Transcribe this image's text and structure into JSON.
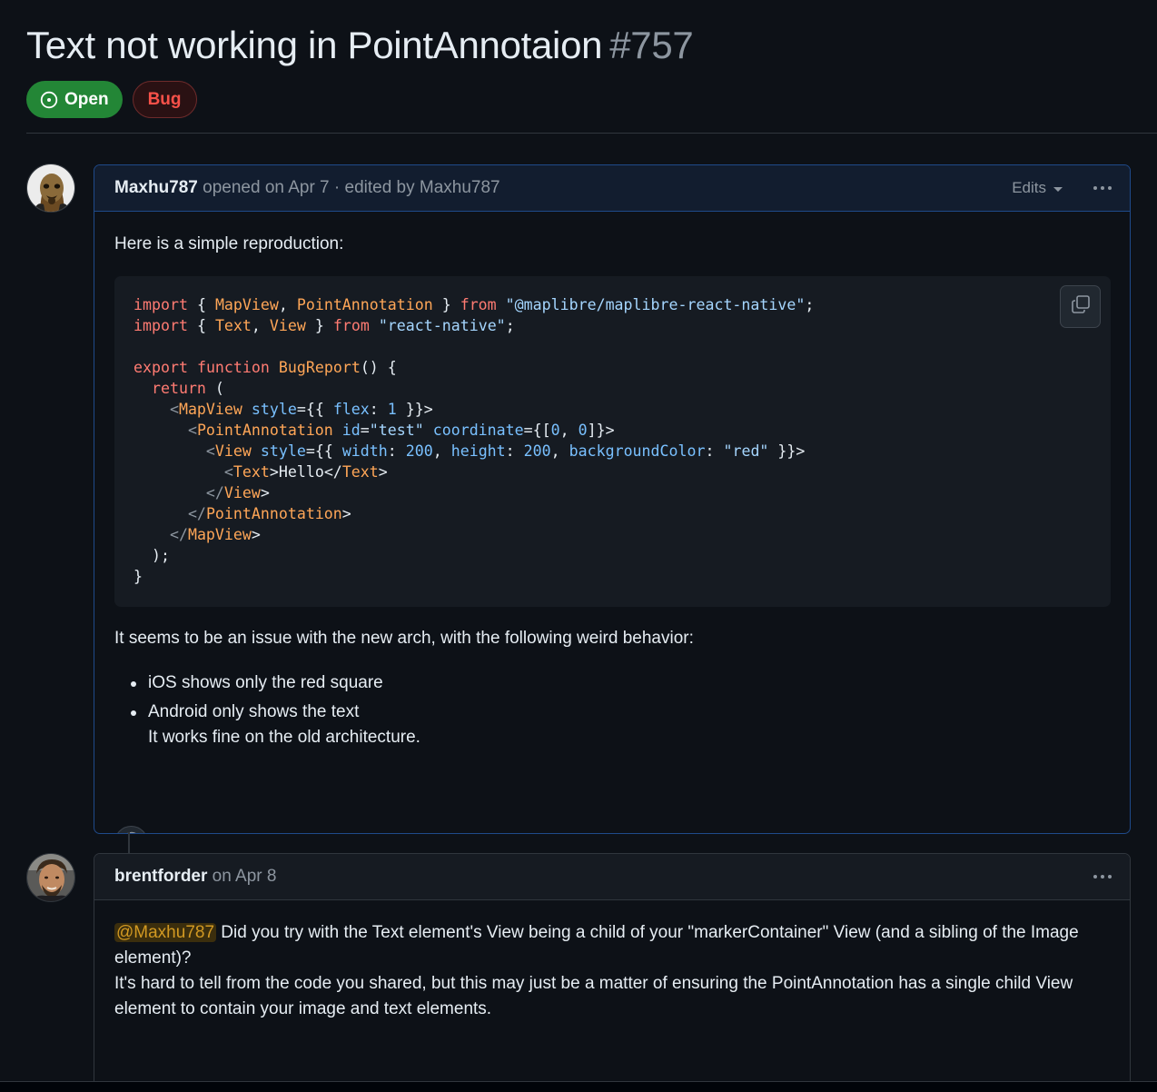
{
  "issue": {
    "title": "Text not working in PointAnnotaion",
    "number": "#757",
    "state": "Open",
    "label": "Bug"
  },
  "colors": {
    "background": "#0d1117",
    "open_badge": "#238636",
    "bug_label": "#f85149",
    "author_border": "#1f4a8a"
  },
  "comments": [
    {
      "author": "Maxhu787",
      "meta": " opened on Apr 7 · edited by Maxhu787",
      "edits_label": "Edits",
      "intro": "Here is a simple reproduction:",
      "code": {
        "line1": {
          "p1": "import",
          "p2": " { ",
          "p3": "MapView",
          "p4": ", ",
          "p5": "PointAnnotation",
          "p6": " } ",
          "p7": "from",
          "p8": " ",
          "p9": "\"@maplibre/maplibre-react-native\"",
          "p10": ";"
        },
        "line2": {
          "p1": "import",
          "p2": " { ",
          "p3": "Text",
          "p4": ", ",
          "p5": "View",
          "p6": " } ",
          "p7": "from",
          "p8": " ",
          "p9": "\"react-native\"",
          "p10": ";"
        },
        "line4": {
          "p1": "export",
          "p2": " ",
          "p3": "function",
          "p4": " ",
          "p5": "BugReport",
          "p6": "() {"
        },
        "line5": {
          "p1": "  ",
          "p2": "return",
          "p3": " ("
        },
        "line6": {
          "p1": "    <",
          "p2": "MapView",
          "p3": " ",
          "p4": "style",
          "p5": "={{ ",
          "p6": "flex",
          "p7": ": ",
          "p8": "1",
          "p9": " }}>"
        },
        "line7": {
          "p1": "      <",
          "p2": "PointAnnotation",
          "p3": " ",
          "p4": "id",
          "p5": "=",
          "p6": "\"test\"",
          "p7": " ",
          "p8": "coordinate",
          "p9": "={[",
          "p10": "0",
          "p11": ", ",
          "p12": "0",
          "p13": "]}>"
        },
        "line8": {
          "p1": "        <",
          "p2": "View",
          "p3": " ",
          "p4": "style",
          "p5": "={{ ",
          "p6": "width",
          "p7": ": ",
          "p8": "200",
          "p9": ", ",
          "p10": "height",
          "p11": ": ",
          "p12": "200",
          "p13": ", ",
          "p14": "backgroundColor",
          "p15": ": ",
          "p16": "\"red\"",
          "p17": " }}>"
        },
        "line9": {
          "p1": "          <",
          "p2": "Text",
          "p3": ">Hello</",
          "p4": "Text",
          "p5": ">"
        },
        "line10": {
          "p1": "        </",
          "p2": "View",
          "p3": ">"
        },
        "line11": {
          "p1": "      </",
          "p2": "PointAnnotation",
          "p3": ">"
        },
        "line12": {
          "p1": "    </",
          "p2": "MapView",
          "p3": ">"
        },
        "line13": "  );",
        "line14": "}"
      },
      "after_code": "It seems to be an issue with the new arch, with the following weird behavior:",
      "bullets": [
        "iOS shows only the red square",
        "Android only shows the text"
      ],
      "bullet_note": "It works fine on the old architecture."
    },
    {
      "author": "brentforder",
      "meta": " on Apr 8",
      "mention": "@Maxhu787",
      "reply_line1": " Did you try with the Text element's View being a child of your \"markerContainer\" View (and a sibling of the Image element)?",
      "reply_line2": "It's hard to tell from the code you shared, but this may just be a matter of ensuring the PointAnnotation has a single child View element to contain your image and text elements."
    }
  ]
}
